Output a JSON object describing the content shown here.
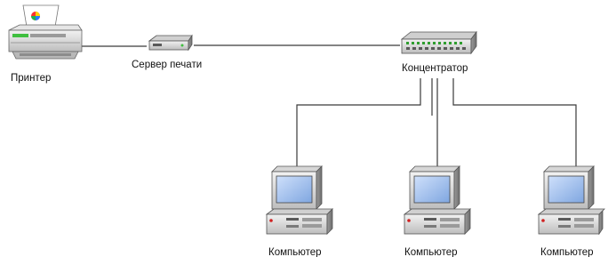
{
  "nodes": {
    "printer": {
      "label": "Принтер",
      "icon": "printer-icon"
    },
    "print_server": {
      "label": "Сервер печати",
      "icon": "print-server-icon"
    },
    "hub": {
      "label": "Концентратор",
      "icon": "hub-icon"
    },
    "computers": [
      {
        "label": "Компьютер",
        "icon": "computer-icon"
      },
      {
        "label": "Компьютер",
        "icon": "computer-icon"
      },
      {
        "label": "Компьютер",
        "icon": "computer-icon"
      }
    ]
  },
  "connections": [
    {
      "from": "printer",
      "to": "print_server"
    },
    {
      "from": "print_server",
      "to": "hub"
    },
    {
      "from": "hub",
      "to": "computer-1"
    },
    {
      "from": "hub",
      "to": "computer-2"
    },
    {
      "from": "hub",
      "to": "computer-3"
    }
  ],
  "colors": {
    "line": "#3a3a3a",
    "device_body": "#d8d8d8",
    "device_dark": "#5a5a5a",
    "screen": "#8fb3e8",
    "screen_highlight": "#c9dcf7",
    "printer_accent": "#3fbf3f",
    "hub_lights": "#ffcc00",
    "power_led": "#d02020"
  }
}
